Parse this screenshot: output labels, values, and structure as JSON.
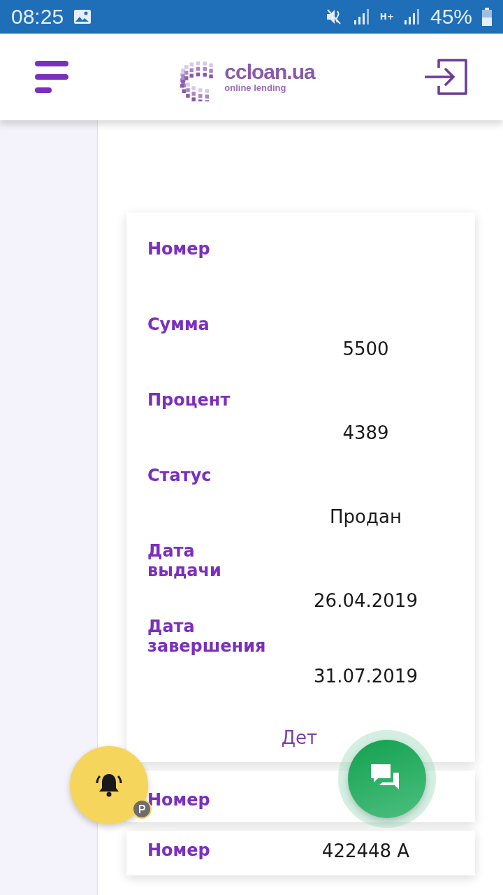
{
  "status_bar": {
    "time": "08:25",
    "network": "H+",
    "battery": "45%"
  },
  "header": {
    "brand": "ccloan.ua",
    "tagline": "online lending"
  },
  "cards": [
    {
      "rows": [
        {
          "label": "Номер"
        },
        {
          "label": "Сумма",
          "value": "5500"
        },
        {
          "label": "Процент",
          "value": "4389"
        },
        {
          "label": "Статус",
          "value": "Продан"
        },
        {
          "label": "Дата выдачи",
          "value": "26.04.2019"
        },
        {
          "label": "Дата завершения",
          "value": "31.07.2019"
        }
      ],
      "link": "Дет"
    },
    {
      "rows": [
        {
          "label": "Номер"
        }
      ]
    },
    {
      "rows": [
        {
          "label": "Номер",
          "value": "422448 A"
        }
      ]
    }
  ]
}
